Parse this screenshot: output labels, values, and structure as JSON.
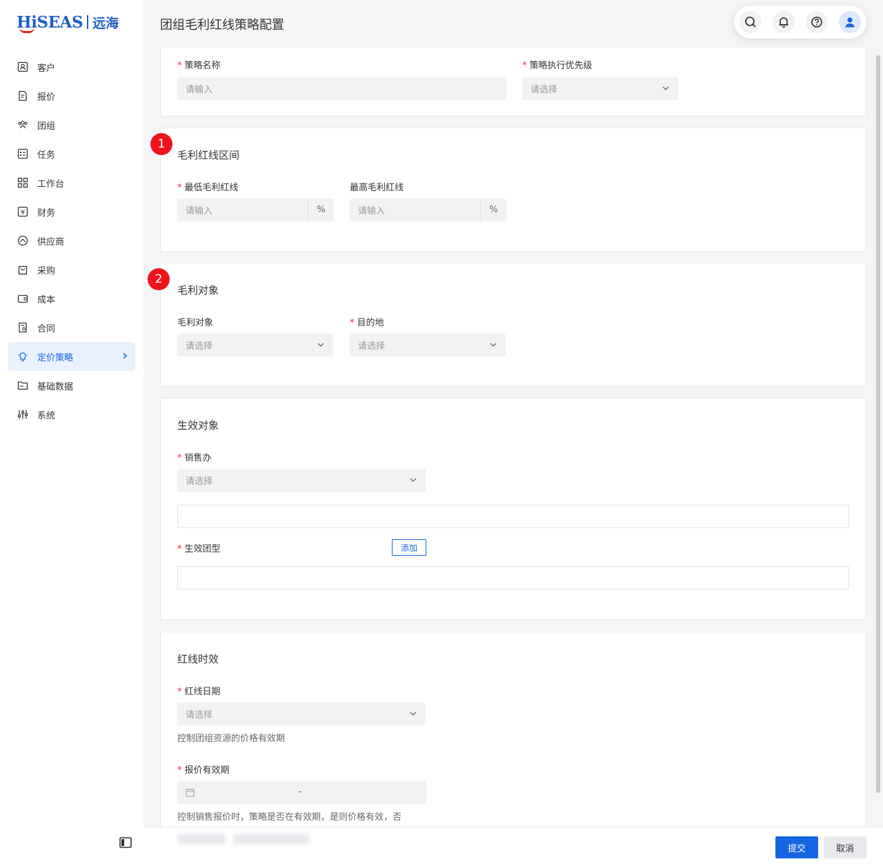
{
  "brand": {
    "en": "HiSEAS",
    "cn": "远海"
  },
  "sidebar": {
    "items": [
      {
        "label": "客户",
        "icon": "customer-icon"
      },
      {
        "label": "报价",
        "icon": "quote-icon"
      },
      {
        "label": "团组",
        "icon": "group-icon"
      },
      {
        "label": "任务",
        "icon": "task-icon"
      },
      {
        "label": "工作台",
        "icon": "workbench-icon"
      },
      {
        "label": "财务",
        "icon": "finance-icon"
      },
      {
        "label": "供应商",
        "icon": "supplier-icon"
      },
      {
        "label": "采购",
        "icon": "purchase-icon"
      },
      {
        "label": "成本",
        "icon": "cost-icon"
      },
      {
        "label": "合同",
        "icon": "contract-icon"
      },
      {
        "label": "定价策略",
        "icon": "bulb-icon",
        "active": true
      },
      {
        "label": "基础数据",
        "icon": "folder-icon"
      },
      {
        "label": "系统",
        "icon": "sliders-icon"
      }
    ]
  },
  "header": {
    "title": "团组毛利红线策略配置"
  },
  "form": {
    "strategy_name": {
      "label": "策略名称",
      "placeholder": "请输入"
    },
    "priority": {
      "label": "策略执行优先级",
      "placeholder": "请选择"
    },
    "section1": {
      "badge": "1",
      "title": "毛利红线区间"
    },
    "min_line": {
      "label": "最低毛利红线",
      "placeholder": "请输入",
      "suffix": "%"
    },
    "max_line": {
      "label": "最高毛利红线",
      "placeholder": "请输入",
      "suffix": "%"
    },
    "section2": {
      "badge": "2",
      "title": "毛利对象"
    },
    "margin_object": {
      "label": "毛利对象",
      "placeholder": "请选择"
    },
    "destination": {
      "label": "目的地",
      "placeholder": "请选择"
    },
    "section3": {
      "title": "生效对象"
    },
    "sales_office": {
      "label": "销售办",
      "placeholder": "请选择"
    },
    "group_type": {
      "label": "生效团型",
      "add_label": "添加"
    },
    "section4": {
      "title": "红线时效"
    },
    "redline_date": {
      "label": "红线日期",
      "placeholder": "请选择",
      "hint": "控制团组资源的价格有效期"
    },
    "quote_validity": {
      "label": "报价有效期",
      "separator": "-",
      "hint": "控制销售报价时，策略是否在有效期，是则价格有效，否"
    }
  },
  "footer": {
    "submit": "提交",
    "cancel": "取消"
  }
}
